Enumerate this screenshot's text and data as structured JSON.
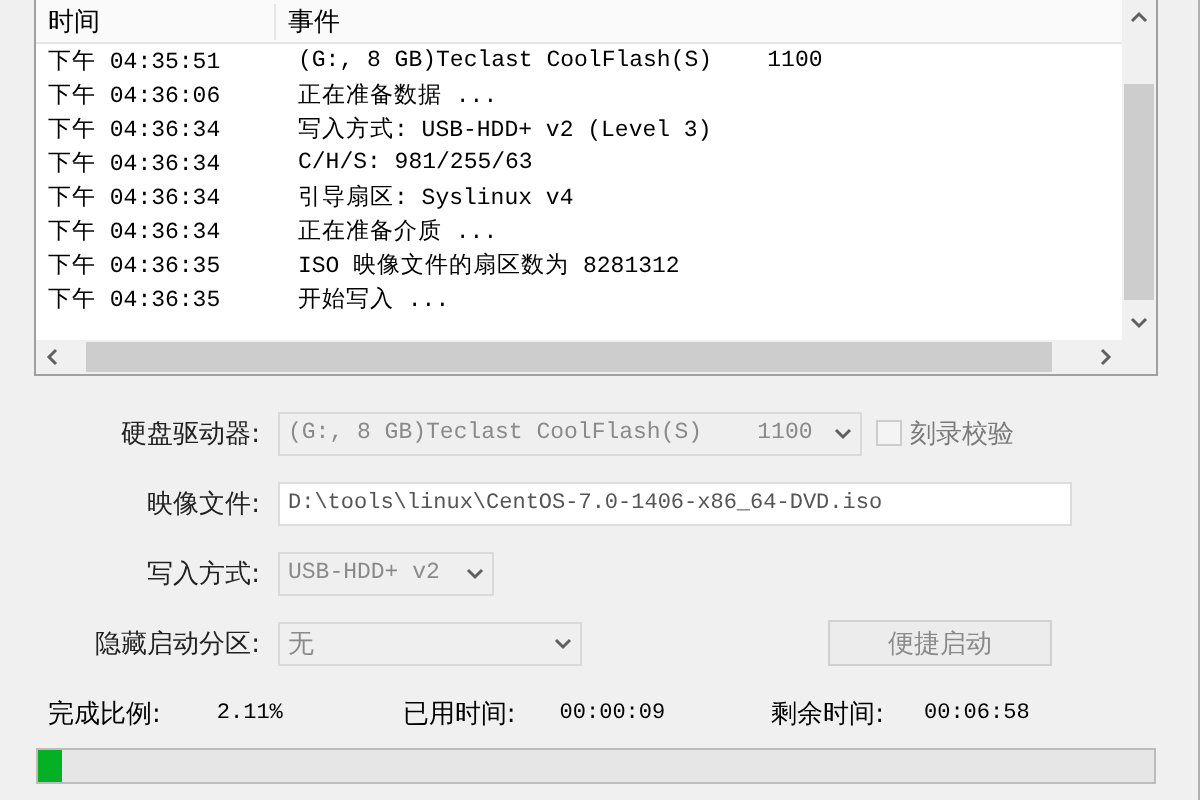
{
  "log": {
    "columns": [
      "时间",
      "事件"
    ],
    "rows": [
      {
        "time": "下午 04:35:51",
        "event": "(G:, 8 GB)Teclast CoolFlash(S)    1100"
      },
      {
        "time": "下午 04:36:06",
        "event": "正在准备数据 ..."
      },
      {
        "time": "下午 04:36:34",
        "event": "写入方式: USB-HDD+ v2 (Level 3)"
      },
      {
        "time": "下午 04:36:34",
        "event": "C/H/S: 981/255/63"
      },
      {
        "time": "下午 04:36:34",
        "event": "引导扇区: Syslinux v4"
      },
      {
        "time": "下午 04:36:34",
        "event": "正在准备介质 ..."
      },
      {
        "time": "下午 04:36:35",
        "event": "ISO 映像文件的扇区数为 8281312"
      },
      {
        "time": "下午 04:36:35",
        "event": "开始写入 ..."
      }
    ]
  },
  "form": {
    "drive": {
      "label": "硬盘驱动器:",
      "value": "(G:, 8 GB)Teclast CoolFlash(S)    1100",
      "disabled": true
    },
    "verify": {
      "label": "刻录校验",
      "checked": false,
      "disabled": true
    },
    "image_file": {
      "label": "映像文件:",
      "value": "D:\\tools\\linux\\CentOS-7.0-1406-x86_64-DVD.iso"
    },
    "write_mode": {
      "label": "写入方式:",
      "value": "USB-HDD+ v2",
      "disabled": true
    },
    "hidden_partition": {
      "label": "隐藏启动分区:",
      "value": "无",
      "disabled": true
    },
    "quick_boot_button": {
      "label": "便捷启动",
      "disabled": true
    }
  },
  "progress": {
    "percent_label": "完成比例:",
    "percent": "2.11%",
    "elapsed_label": "已用时间:",
    "elapsed": "00:00:09",
    "remaining_label": "剩余时间:",
    "remaining": "00:06:58",
    "level": 0.0211
  }
}
